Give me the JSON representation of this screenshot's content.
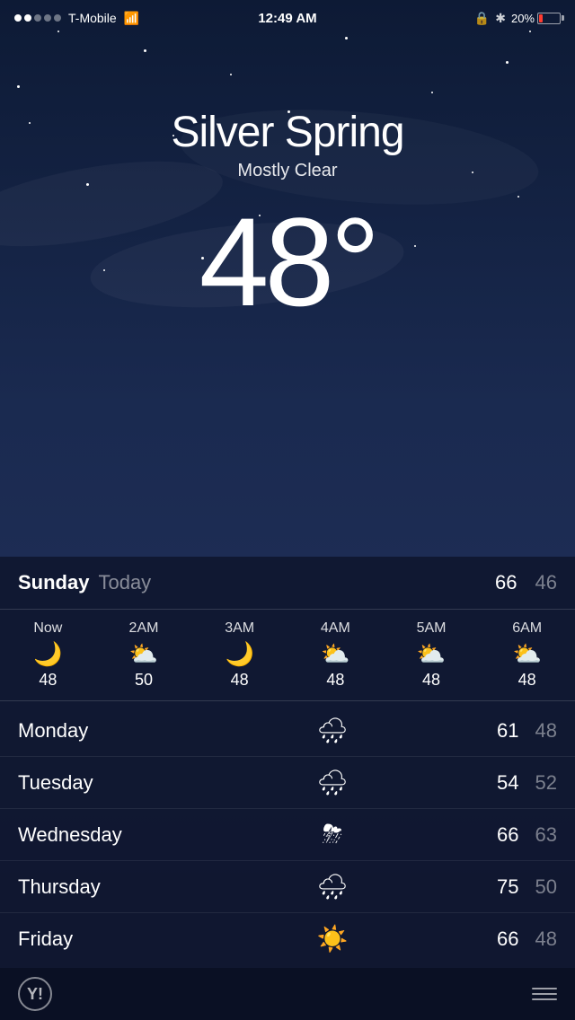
{
  "statusBar": {
    "carrier": "T-Mobile",
    "time": "12:49 AM",
    "battery_percent": "20%",
    "signal_dots": [
      true,
      true,
      false,
      false,
      false
    ]
  },
  "weather": {
    "city": "Silver Spring",
    "condition": "Mostly Clear",
    "temperature": "48°",
    "today_high": "66",
    "today_low": "46"
  },
  "today_label": "Today",
  "sunday_label": "Sunday",
  "hourly": [
    {
      "label": "Now",
      "icon": "🌙",
      "temp": "48"
    },
    {
      "label": "2AM",
      "icon": "⛅",
      "temp": "50"
    },
    {
      "label": "3AM",
      "icon": "🌙",
      "temp": "48"
    },
    {
      "label": "4AM",
      "icon": "⛅",
      "temp": "48"
    },
    {
      "label": "5AM",
      "icon": "⛅",
      "temp": "48"
    },
    {
      "label": "6AM",
      "icon": "⛅",
      "temp": "48"
    }
  ],
  "daily": [
    {
      "day": "Monday",
      "icon": "🌧",
      "high": "61",
      "low": "48"
    },
    {
      "day": "Tuesday",
      "icon": "🌧",
      "high": "54",
      "low": "52"
    },
    {
      "day": "Wednesday",
      "icon": "⛈",
      "high": "66",
      "low": "63"
    },
    {
      "day": "Thursday",
      "icon": "🌧",
      "high": "75",
      "low": "50"
    },
    {
      "day": "Friday",
      "icon": "☀️",
      "high": "66",
      "low": "48"
    }
  ],
  "footer": {
    "yahoo_text": "Y!",
    "menu_label": "menu"
  }
}
